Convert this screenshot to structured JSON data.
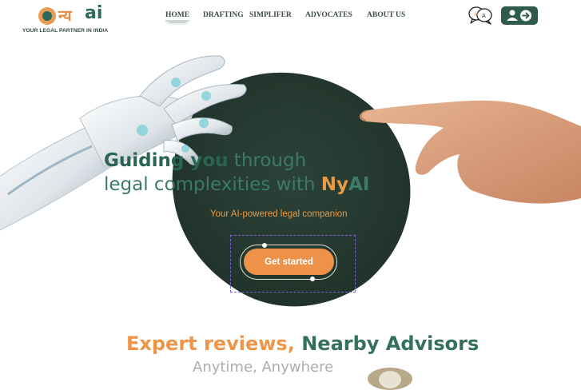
{
  "header": {
    "logo_hindi": "न्य",
    "logo_ai": "ai",
    "tagline": "YOUR LEGAL PARTNER IN INDIA",
    "nav": [
      {
        "label": "HOME",
        "active": true
      },
      {
        "label": "DRAFTING"
      },
      {
        "label": "SIMPLIFER"
      },
      {
        "label": "ADVOCATES"
      },
      {
        "label": "ABOUT US"
      }
    ],
    "language_icon": "translate-icon",
    "login_icon": "user-login-icon"
  },
  "hero": {
    "line1_a": "Guiding you",
    "line1_b": " through",
    "line2_a": "legal complexities with ",
    "line2_brand_ny": "Ny",
    "line2_brand_ai": "AI",
    "subtitle": "Your AI-powered legal companion",
    "cta_label": "Get started"
  },
  "section": {
    "title_a": "Expert reviews,",
    "title_b": " Nearby Advisors",
    "subtitle": "Anytime, Anywhere"
  },
  "colors": {
    "brand_green": "#2a6453",
    "brand_orange": "#e99a42",
    "blob": "#253b33",
    "login_bg": "#2f5b4d"
  }
}
